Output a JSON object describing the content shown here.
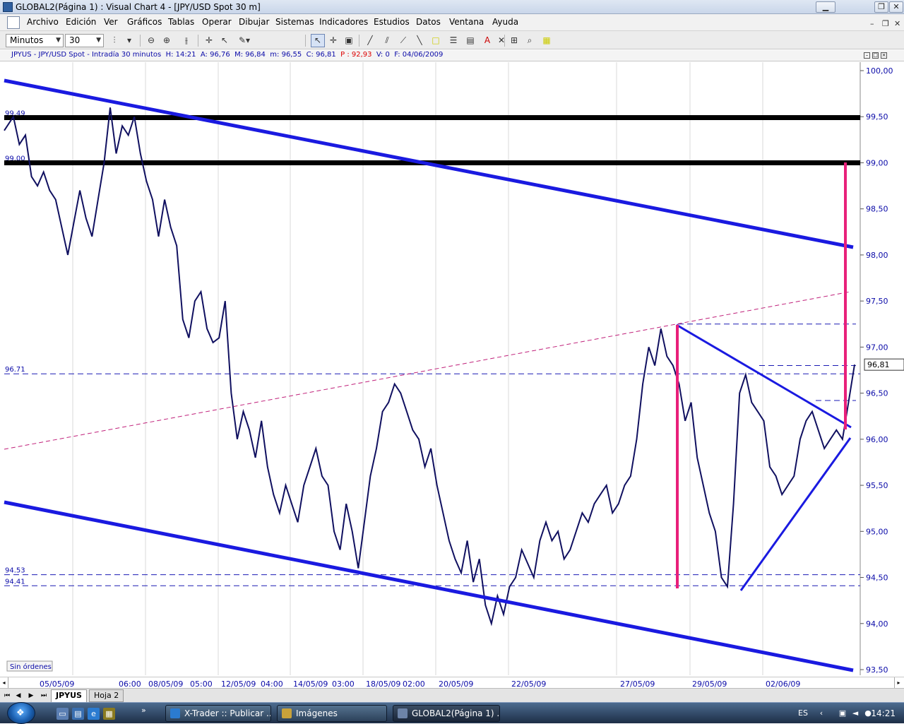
{
  "window": {
    "title": "GLOBAL2(Página 1) : Visual Chart 4 - [JPY/USD Spot 30 m]"
  },
  "menu": [
    "Archivo",
    "Edición",
    "Ver",
    "Gráficos",
    "Tablas",
    "Operar",
    "Dibujar",
    "Sistemas",
    "Indicadores",
    "Estudios",
    "Datos",
    "Ventana",
    "Ayuda"
  ],
  "toolbar": {
    "interval_unit": "Minutos",
    "interval_value": "30"
  },
  "infobar": {
    "symbol": "JPYUS - JPY/USD Spot - Intradía 30 minutos",
    "H_label": "H:",
    "H": "14:21",
    "A_label": "A:",
    "A": "96,76",
    "M_label": "M:",
    "M": "96,84",
    "m_label": "m:",
    "m": "96,55",
    "C_label": "C:",
    "C": "96,81",
    "P_label": "P :",
    "P": "92,93",
    "V_label": "V:",
    "V": "0",
    "F_label": "F:",
    "F": "04/06/2009"
  },
  "chart_data": {
    "type": "line",
    "symbol": "JPYUS",
    "y_ticks": [
      "100,00",
      "99,50",
      "99,00",
      "98,50",
      "98,00",
      "97,50",
      "97,00",
      "96,50",
      "96,00",
      "95,50",
      "95,00",
      "94,50",
      "94,00",
      "93,50"
    ],
    "ylim": [
      93.5,
      100.0
    ],
    "last_price": "96,81",
    "left_labels": [
      {
        "text": "99.49",
        "y": 99.49
      },
      {
        "text": "99.00",
        "y": 99.0
      },
      {
        "text": "96.71",
        "y": 96.71
      },
      {
        "text": "94.53",
        "y": 94.53
      },
      {
        "text": "94.41",
        "y": 94.41
      }
    ],
    "x_labels": [
      "05/05/09",
      "06:00",
      "08/05/09",
      "05:00",
      "12/05/09",
      "04:00",
      "14/05/09",
      "03:00",
      "18/05/09",
      "02:00",
      "20/05/09",
      "22/05/09",
      "27/05/09",
      "29/05/09",
      "02/06/09"
    ],
    "price_path": [
      [
        0,
        99.35
      ],
      [
        3,
        99.5
      ],
      [
        5,
        99.2
      ],
      [
        7,
        99.3
      ],
      [
        9,
        98.85
      ],
      [
        11,
        98.75
      ],
      [
        13,
        98.9
      ],
      [
        15,
        98.7
      ],
      [
        17,
        98.6
      ],
      [
        19,
        98.3
      ],
      [
        21,
        98.0
      ],
      [
        23,
        98.35
      ],
      [
        25,
        98.7
      ],
      [
        27,
        98.4
      ],
      [
        29,
        98.2
      ],
      [
        31,
        98.6
      ],
      [
        33,
        99.0
      ],
      [
        35,
        99.6
      ],
      [
        37,
        99.1
      ],
      [
        39,
        99.4
      ],
      [
        41,
        99.3
      ],
      [
        43,
        99.5
      ],
      [
        45,
        99.1
      ],
      [
        47,
        98.8
      ],
      [
        49,
        98.6
      ],
      [
        51,
        98.2
      ],
      [
        53,
        98.6
      ],
      [
        55,
        98.3
      ],
      [
        57,
        98.1
      ],
      [
        59,
        97.3
      ],
      [
        61,
        97.1
      ],
      [
        63,
        97.5
      ],
      [
        65,
        97.6
      ],
      [
        67,
        97.2
      ],
      [
        69,
        97.05
      ],
      [
        71,
        97.1
      ],
      [
        73,
        97.5
      ],
      [
        75,
        96.5
      ],
      [
        77,
        96.0
      ],
      [
        79,
        96.3
      ],
      [
        81,
        96.1
      ],
      [
        83,
        95.8
      ],
      [
        85,
        96.2
      ],
      [
        87,
        95.7
      ],
      [
        89,
        95.4
      ],
      [
        91,
        95.2
      ],
      [
        93,
        95.5
      ],
      [
        95,
        95.3
      ],
      [
        97,
        95.1
      ],
      [
        99,
        95.5
      ],
      [
        101,
        95.7
      ],
      [
        103,
        95.9
      ],
      [
        105,
        95.6
      ],
      [
        107,
        95.5
      ],
      [
        109,
        95.0
      ],
      [
        111,
        94.8
      ],
      [
        113,
        95.3
      ],
      [
        115,
        95.0
      ],
      [
        117,
        94.6
      ],
      [
        119,
        95.1
      ],
      [
        121,
        95.6
      ],
      [
        123,
        95.9
      ],
      [
        125,
        96.3
      ],
      [
        127,
        96.4
      ],
      [
        129,
        96.6
      ],
      [
        131,
        96.5
      ],
      [
        133,
        96.3
      ],
      [
        135,
        96.1
      ],
      [
        137,
        96.0
      ],
      [
        139,
        95.7
      ],
      [
        141,
        95.9
      ],
      [
        143,
        95.5
      ],
      [
        145,
        95.2
      ],
      [
        147,
        94.9
      ],
      [
        149,
        94.7
      ],
      [
        151,
        94.55
      ],
      [
        153,
        94.9
      ],
      [
        155,
        94.45
      ],
      [
        157,
        94.7
      ],
      [
        159,
        94.2
      ],
      [
        161,
        94.0
      ],
      [
        163,
        94.3
      ],
      [
        165,
        94.1
      ],
      [
        167,
        94.4
      ],
      [
        169,
        94.5
      ],
      [
        171,
        94.8
      ],
      [
        173,
        94.65
      ],
      [
        175,
        94.5
      ],
      [
        177,
        94.9
      ],
      [
        179,
        95.1
      ],
      [
        181,
        94.9
      ],
      [
        183,
        95.0
      ],
      [
        185,
        94.7
      ],
      [
        187,
        94.8
      ],
      [
        189,
        95.0
      ],
      [
        191,
        95.2
      ],
      [
        193,
        95.1
      ],
      [
        195,
        95.3
      ],
      [
        197,
        95.4
      ],
      [
        199,
        95.5
      ],
      [
        201,
        95.2
      ],
      [
        203,
        95.3
      ],
      [
        205,
        95.5
      ],
      [
        207,
        95.6
      ],
      [
        209,
        96.0
      ],
      [
        211,
        96.6
      ],
      [
        213,
        97.0
      ],
      [
        215,
        96.8
      ],
      [
        217,
        97.2
      ],
      [
        219,
        96.9
      ],
      [
        221,
        96.8
      ],
      [
        223,
        96.6
      ],
      [
        225,
        96.2
      ],
      [
        227,
        96.4
      ],
      [
        229,
        95.8
      ],
      [
        231,
        95.5
      ],
      [
        233,
        95.2
      ],
      [
        235,
        95.0
      ],
      [
        237,
        94.5
      ],
      [
        239,
        94.4
      ],
      [
        241,
        95.3
      ],
      [
        243,
        96.5
      ],
      [
        245,
        96.7
      ],
      [
        247,
        96.4
      ],
      [
        249,
        96.3
      ],
      [
        251,
        96.2
      ],
      [
        253,
        95.7
      ],
      [
        255,
        95.6
      ],
      [
        257,
        95.4
      ],
      [
        259,
        95.5
      ],
      [
        261,
        95.6
      ],
      [
        263,
        96.0
      ],
      [
        265,
        96.2
      ],
      [
        267,
        96.3
      ],
      [
        269,
        96.1
      ],
      [
        271,
        95.9
      ],
      [
        273,
        96.0
      ],
      [
        275,
        96.1
      ],
      [
        277,
        96.0
      ],
      [
        279,
        96.4
      ],
      [
        281,
        96.81
      ]
    ]
  },
  "overlays": {
    "status_label": "Sin órdenes"
  },
  "sheets": [
    "JPYUS",
    "Hoja 2"
  ],
  "taskbar": {
    "tasks": [
      "X-Trader :: Publicar ...",
      "Imágenes",
      "GLOBAL2(Página 1) ..."
    ],
    "lang": "ES",
    "time": "14:21"
  }
}
